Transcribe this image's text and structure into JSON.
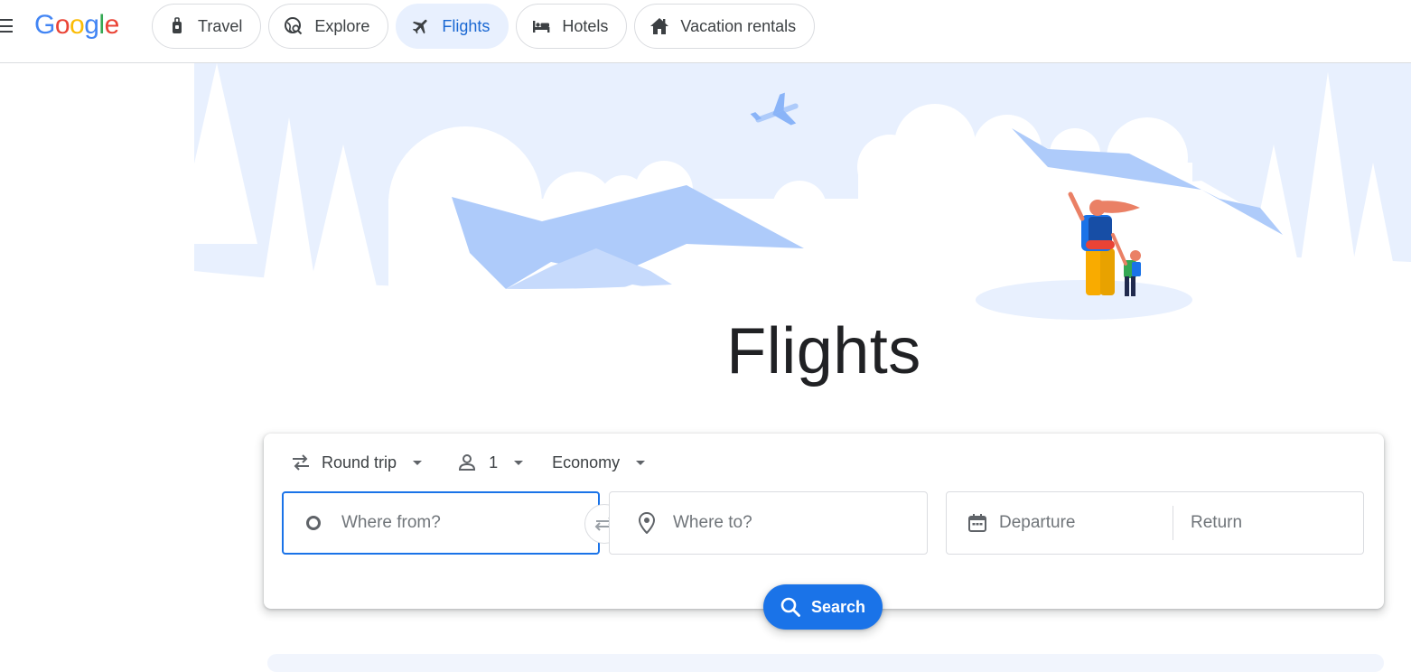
{
  "brand": {
    "logo_letters": [
      "G",
      "o",
      "o",
      "g",
      "l",
      "e"
    ],
    "logo_colors": [
      "#4285F4",
      "#EA4335",
      "#FBBC05",
      "#4285F4",
      "#34A853",
      "#EA4335"
    ]
  },
  "header": {
    "menu_icon": "hamburger-menu-icon",
    "tabs": [
      {
        "label": "Travel",
        "icon": "luggage-icon",
        "active": false
      },
      {
        "label": "Explore",
        "icon": "explore-globe-icon",
        "active": false
      },
      {
        "label": "Flights",
        "icon": "airplane-icon",
        "active": true
      },
      {
        "label": "Hotels",
        "icon": "bed-icon",
        "active": false
      },
      {
        "label": "Vacation rentals",
        "icon": "house-icon",
        "active": false
      }
    ]
  },
  "hero": {
    "title": "Flights",
    "illustration": "mountains-and-hikers-illustration"
  },
  "search": {
    "trip_type": "Round trip",
    "passengers": "1",
    "cabin_class": "Economy",
    "from_placeholder": "Where from?",
    "to_placeholder": "Where to?",
    "departure_placeholder": "Departure",
    "return_placeholder": "Return",
    "search_label": "Search"
  },
  "colors": {
    "accent": "#1a73e8",
    "active_chip_bg": "#e8f0fe",
    "hero_sky": "#e8f0fe",
    "hero_mountain": "#aecbfa"
  }
}
